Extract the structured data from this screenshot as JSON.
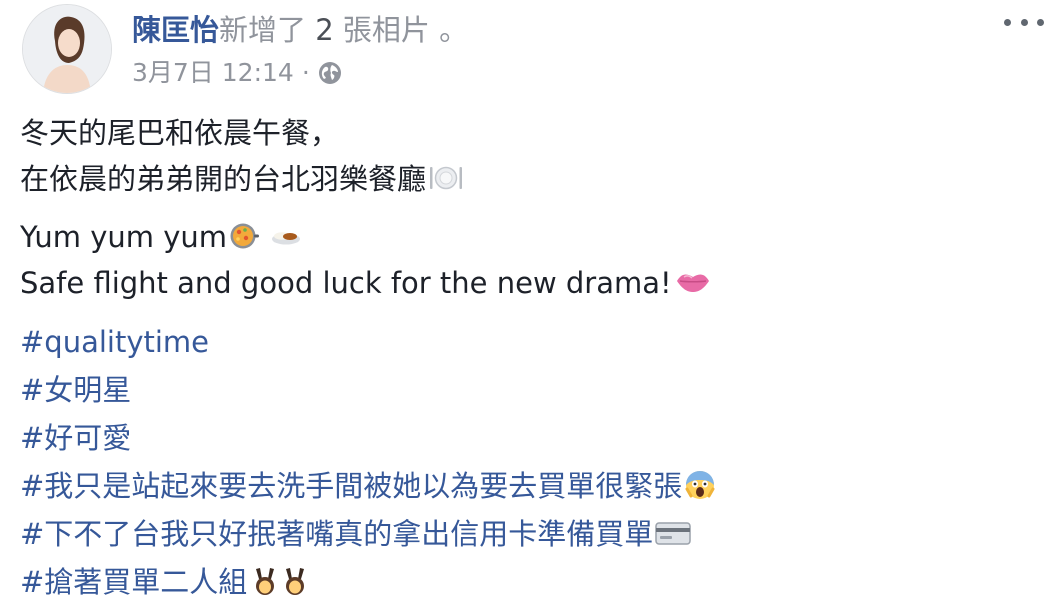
{
  "post": {
    "author_name": "陳匡怡",
    "action_text": "新增了",
    "photo_count": "2",
    "photo_suffix": "張相片",
    "period": "。",
    "timestamp": "3月7日 12:14",
    "separator": "·",
    "privacy_icon": "globe-icon",
    "more_icon": "ellipsis-icon"
  },
  "content": {
    "paragraph1": [
      "冬天的尾巴和依晨午餐，",
      "在依晨的弟弟開的台北羽樂餐廳"
    ],
    "paragraph2": [
      "Yum yum yum",
      "Safe flight and good luck for the new drama!"
    ],
    "hashtags": [
      "#qualitytime",
      "#女明星",
      "#好可愛",
      "#我只是站起來要去洗手間被她以為要去買單很緊張",
      "#下不了台我只好抿著嘴真的拿出信用卡準備買單",
      "#搶著買單二人組"
    ],
    "emoji": {
      "restaurant": "plate-cutlery-icon",
      "food1": "paella-pan-icon",
      "food2": "curry-rice-icon",
      "kiss": "kiss-lips-icon",
      "scream": "scream-face-icon",
      "card": "credit-card-icon",
      "bunny": "bunny-ears-girls-icon"
    }
  },
  "colors": {
    "link": "#365899",
    "text": "#1d2129",
    "meta": "#90949c"
  }
}
